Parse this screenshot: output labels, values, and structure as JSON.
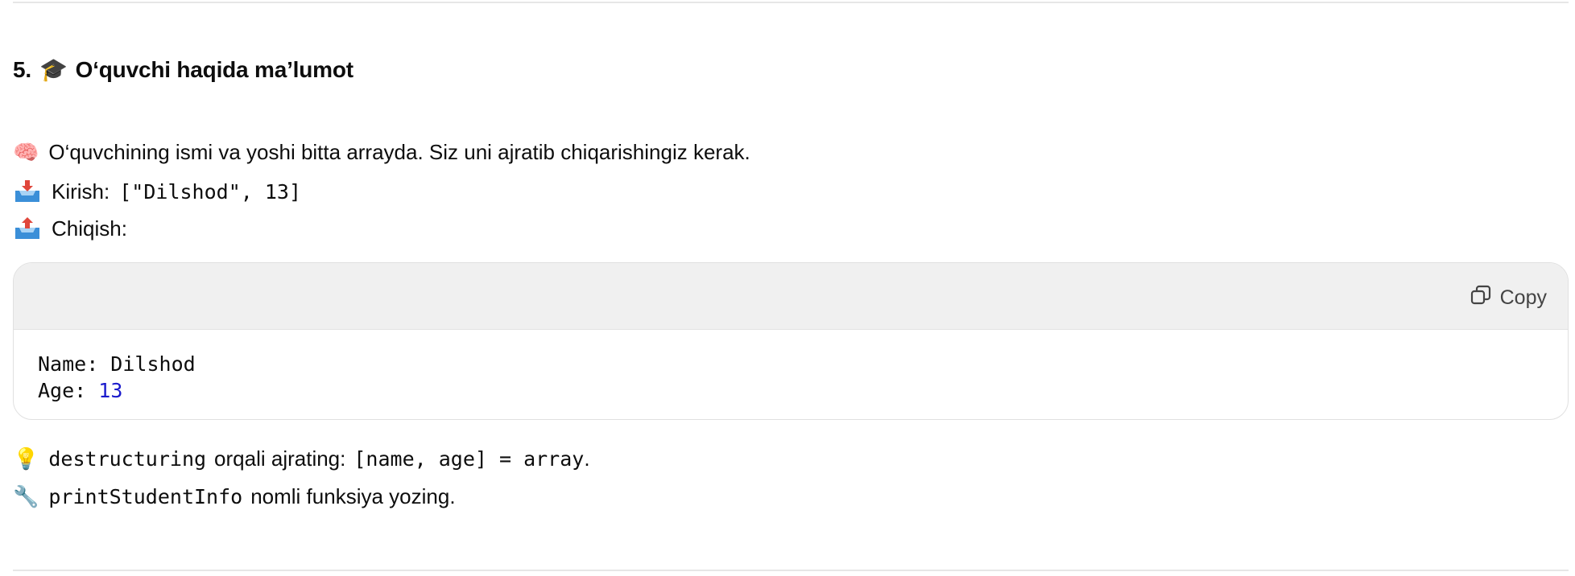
{
  "task": {
    "number": "5.",
    "heading_emoji": "🎓",
    "title": "O‘quvchi haqida ma’lumot"
  },
  "description": {
    "emoji": "🧠",
    "text": "O‘quvchining ismi va yoshi bitta arrayda. Siz uni ajratib chiqarishingiz kerak."
  },
  "input": {
    "label": "Kirish:",
    "value": "[\"Dilshod\", 13]"
  },
  "output": {
    "label": "Chiqish:"
  },
  "code": {
    "copy_label": "Copy",
    "line1": "Name: Dilshod",
    "line2_key": "Age: ",
    "line2_value": "13"
  },
  "hint": {
    "emoji": "💡",
    "code1": "destructuring",
    "text1": "orqali ajrating:",
    "code2": "[name, age] = array",
    "text2": "."
  },
  "tip": {
    "emoji": "🔧",
    "code": "printStudentInfo",
    "text": "nomli funksiya yozing."
  }
}
